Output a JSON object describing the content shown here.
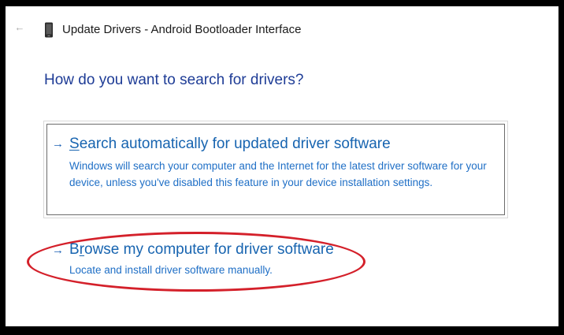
{
  "header": {
    "back_icon": "back-arrow-icon",
    "device_icon": "phone-device-icon",
    "title": "Update Drivers - Android Bootloader Interface"
  },
  "main": {
    "question": "How do you want to search for drivers?",
    "options": [
      {
        "arrow": "→",
        "title_access_key": "S",
        "title_rest": "earch automatically for updated driver software",
        "description": "Windows will search your computer and the Internet for the latest driver software for your device, unless you've disabled this feature in your device installation settings."
      },
      {
        "arrow": "→",
        "title_first": "B",
        "title_access_key": "r",
        "title_rest": "owse my computer for driver software",
        "description": "Locate and install driver software manually."
      }
    ]
  },
  "colors": {
    "heading": "#1e3c96",
    "link": "#1764b0",
    "annotation_circle": "#d4202a"
  }
}
